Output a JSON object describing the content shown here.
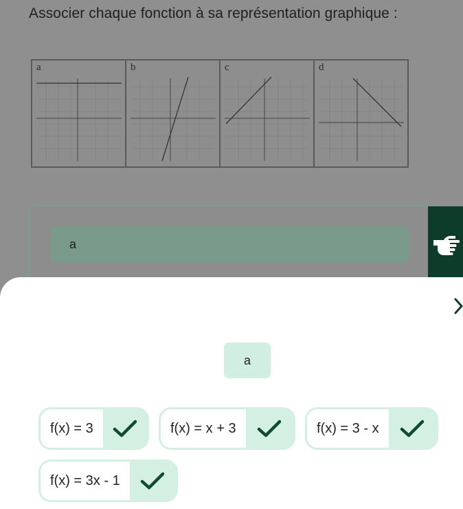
{
  "question": {
    "text": "Associer chaque fonction à sa représentation graphique :"
  },
  "graphs": [
    {
      "letter": "a"
    },
    {
      "letter": "b"
    },
    {
      "letter": "c"
    },
    {
      "letter": "d"
    }
  ],
  "answer": {
    "selected": "a"
  },
  "drop_zone": {
    "label": "a"
  },
  "options": [
    {
      "label": "f(x) = 3"
    },
    {
      "label": "f(x) = x + 3"
    },
    {
      "label": "f(x) = 3 - x"
    },
    {
      "label": "f(x) = 3x - 1"
    }
  ],
  "icons": {
    "hand": "pointing-hand-icon",
    "chevron": "chevron-right-icon",
    "check": "check-icon"
  },
  "colors": {
    "accent_dark": "#0d3d2a",
    "accent_light": "#d4f0e2",
    "check": "#0f4a32"
  }
}
